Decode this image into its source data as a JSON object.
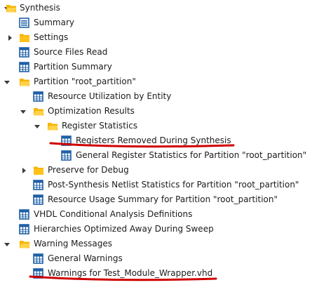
{
  "tree": {
    "rows": [
      {
        "label": "Synthesis",
        "icon": "folder-open-icon",
        "toggle": "expanded"
      },
      {
        "label": "Summary",
        "icon": "summary-list-icon",
        "toggle": "none"
      },
      {
        "label": "Settings",
        "icon": "folder-closed-icon",
        "toggle": "collapsed"
      },
      {
        "label": "Source Files Read",
        "icon": "table-report-icon",
        "toggle": "none"
      },
      {
        "label": "Partition Summary",
        "icon": "table-report-icon",
        "toggle": "none"
      },
      {
        "label": "Partition \"root_partition\"",
        "icon": "folder-open-icon",
        "toggle": "expanded"
      },
      {
        "label": "Resource Utilization by Entity",
        "icon": "table-report-icon",
        "toggle": "none"
      },
      {
        "label": "Optimization Results",
        "icon": "folder-open-icon",
        "toggle": "expanded"
      },
      {
        "label": "Register Statistics",
        "icon": "folder-open-icon",
        "toggle": "expanded"
      },
      {
        "label": "Registers Removed During Synthesis",
        "icon": "table-report-icon",
        "toggle": "none"
      },
      {
        "label": "General Register Statistics for Partition \"root_partition\"",
        "icon": "table-report-icon",
        "toggle": "none"
      },
      {
        "label": "Preserve for Debug",
        "icon": "folder-closed-icon",
        "toggle": "collapsed"
      },
      {
        "label": "Post-Synthesis Netlist Statistics for Partition \"root_partition\"",
        "icon": "table-report-icon",
        "toggle": "none"
      },
      {
        "label": "Resource Usage Summary for Partition \"root_partition\"",
        "icon": "table-report-icon",
        "toggle": "none"
      },
      {
        "label": "VHDL Conditional Analysis Definitions",
        "icon": "table-report-icon",
        "toggle": "none"
      },
      {
        "label": "Hierarchies Optimized Away During Sweep",
        "icon": "table-report-icon",
        "toggle": "none"
      },
      {
        "label": "Warning Messages",
        "icon": "folder-open-icon",
        "toggle": "expanded"
      },
      {
        "label": "General Warnings",
        "icon": "table-report-icon",
        "toggle": "none"
      },
      {
        "label": "Warnings for Test_Module_Wrapper.vhd",
        "icon": "table-report-icon",
        "toggle": "none"
      }
    ]
  },
  "colors": {
    "folder": "#f6b400",
    "folder_light": "#ffd24a",
    "report_icon": "#1f5fa6",
    "annotation": "#d00000",
    "arrow": "#3a3a3a"
  }
}
